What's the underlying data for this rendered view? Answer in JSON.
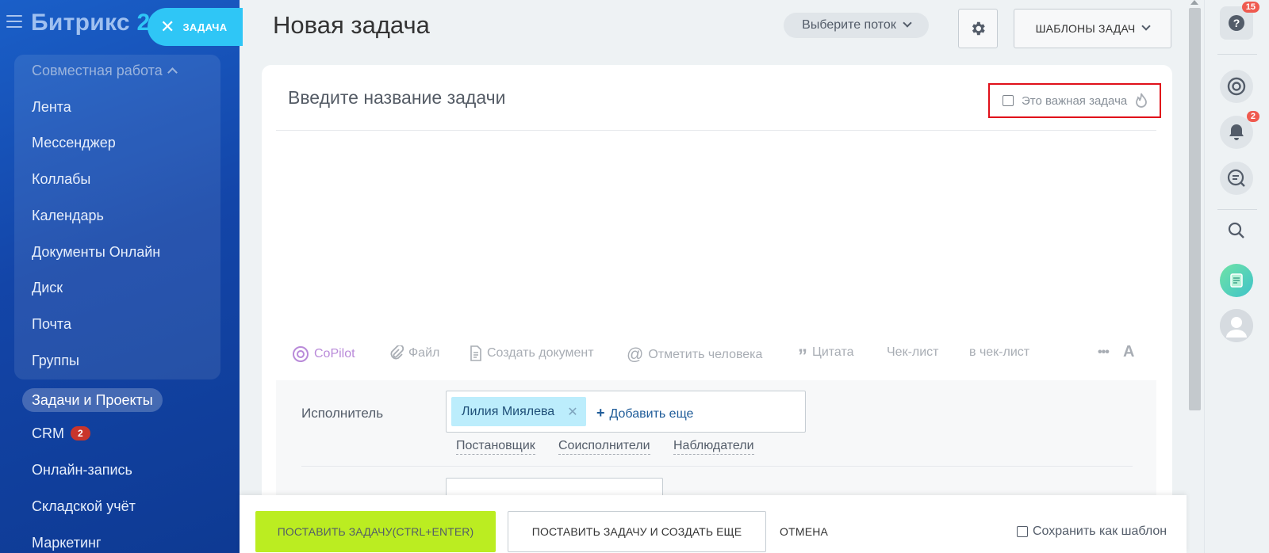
{
  "sidebar": {
    "logo_text": "Битрикс",
    "logo_number": "2",
    "task_button_label": "ЗАДАЧА",
    "group_title": "Совместная работа",
    "group_items": [
      "Лента",
      "Мессенджер",
      "Коллабы",
      "Календарь",
      "Документы Онлайн",
      "Диск",
      "Почта",
      "Группы"
    ],
    "active_item": "Задачи и Проекты",
    "crm_label": "CRM",
    "crm_badge": "2",
    "more_items": [
      "Онлайн-запись",
      "Складской учёт",
      "Маркетинг"
    ]
  },
  "header": {
    "title": "Новая задача",
    "flow_button": "Выберите поток",
    "templates_button": "ШАБЛОНЫ ЗАДАЧ"
  },
  "form": {
    "title_placeholder": "Введите название задачи",
    "important_label": "Это важная задача",
    "important_checked": false,
    "toolbar": {
      "copilot": "CoPilot",
      "file": "Файл",
      "create_doc": "Создать документ",
      "mention": "Отметить человека",
      "quote": "Цитата",
      "checklist": "Чек-лист",
      "to_checklist": "в чек-лист",
      "more": "•••",
      "format": "A"
    },
    "assignee_label": "Исполнитель",
    "assignee_name": "Лилия Миялева",
    "add_more": "Добавить еще",
    "role_links": [
      "Постановщик",
      "Соисполнители",
      "Наблюдатели"
    ]
  },
  "footer": {
    "submit": "ПОСТАВИТЬ ЗАДАЧУ(CTRL+ENTER)",
    "submit_and_new": "ПОСТАВИТЬ ЗАДАЧУ И СОЗДАТЬ ЕЩЕ",
    "cancel": "ОТМЕНА",
    "save_template": "Сохранить как шаблон"
  },
  "rail": {
    "help_badge": "15",
    "notifications_badge": "2",
    "icons": [
      "help-icon",
      "copilot-icon",
      "bell-icon",
      "chat-search-icon",
      "search-icon",
      "news-icon",
      "user-avatar-icon"
    ]
  },
  "colors": {
    "accent": "#2fc6f6",
    "submit_green": "#bbed21",
    "highlight_red": "#e0101a",
    "sidebar_blue": "#1345a8"
  }
}
